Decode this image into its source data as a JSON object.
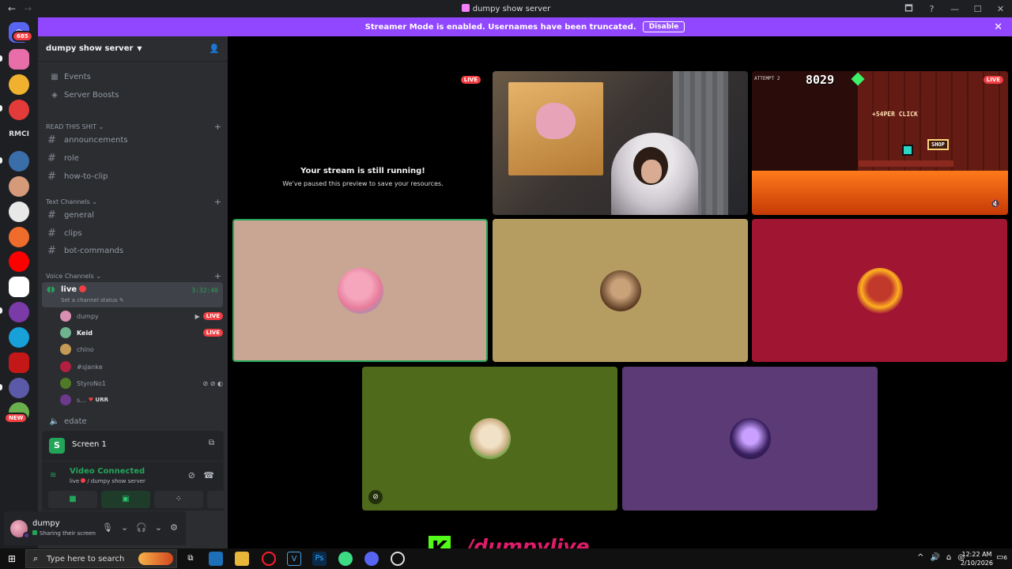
{
  "window": {
    "title": "dumpy show server",
    "back": "←",
    "forward": "→",
    "controls": [
      "🗖",
      "?",
      "—",
      "☐",
      "✕"
    ]
  },
  "banner": {
    "text": "Streamer Mode is enabled. Usernames have been truncated.",
    "button": "Disable",
    "close": "✕"
  },
  "rail": {
    "home_badge": "685",
    "rmci_label": "RMCI",
    "new_badge": "NEW",
    "servers": [
      {
        "color": "#e76ea8"
      },
      {
        "color": "#f0b22e"
      },
      {
        "color": "#e33a3a"
      },
      {
        "color": "#3a6ea8"
      },
      {
        "color": "#d59a7a"
      },
      {
        "color": "#e8e8e8"
      },
      {
        "color": "#f06c2c"
      },
      {
        "color": "#ff0000"
      },
      {
        "color": "#ffffff"
      },
      {
        "color": "#7a3aa8"
      },
      {
        "color": "#18a0d8"
      },
      {
        "color": "#c41818"
      },
      {
        "color": "#5a5aa8"
      },
      {
        "color": "#6ab04c"
      }
    ]
  },
  "sidebar": {
    "server_name": "dumpy show server",
    "top_items": [
      {
        "icon": "▦",
        "label": "Events"
      },
      {
        "icon": "◈",
        "label": "Server Boosts"
      }
    ],
    "categories": {
      "read": "READ THIS SHIT",
      "text": "Text Channels",
      "voice": "Voice Channels"
    },
    "read_channels": [
      "announcements",
      "role",
      "how-to-clip"
    ],
    "text_channels": [
      "general",
      "clips",
      "bot-commands"
    ],
    "voice_live": {
      "name": "live",
      "timer": "3:32:40",
      "status": "Set a channel status"
    },
    "members": [
      {
        "name": "dumpy",
        "color": "#d98fb1",
        "cam": true,
        "live": "LIVE"
      },
      {
        "name": "Keid",
        "color": "#6fb38f",
        "live": "LIVE"
      },
      {
        "name": "chino",
        "color": "#c49a55"
      },
      {
        "name": "#sJankе",
        "color": "#b12040"
      },
      {
        "name": "StyroNo1",
        "color": "#4f7a27",
        "icons": "⊘ ⊘ ◐"
      },
      {
        "name": "s...",
        "color": "#6b3a8a",
        "extra": "URR"
      }
    ],
    "edate": "edate"
  },
  "screen_panel": {
    "label": "Screen 1"
  },
  "voice_panel": {
    "status": "Video Connected",
    "channel": "live",
    "server": "/ dumpy show server"
  },
  "user_panel": {
    "name": "dumpy",
    "status": "Sharing their screen"
  },
  "stage": {
    "paused_title": "Your stream is still running!",
    "paused_sub": "We've paused this preview to save your resources.",
    "live_tag": "LIVE",
    "game": {
      "score": "8029",
      "attempt": "ATTEMPT 2",
      "per_click": "+54PER CLICK",
      "shop": "SHOP"
    },
    "tiles": [
      {
        "bg": "#c9a593"
      },
      {
        "bg": "#b59d62"
      },
      {
        "bg": "#a01532"
      },
      {
        "bg": "#4f6a1b"
      },
      {
        "bg": "#5c3a75"
      }
    ]
  },
  "overlay": {
    "k": "K",
    "handle": "/dumpylive"
  },
  "taskbar": {
    "search_placeholder": "Type here to search",
    "time": "12:22 AM",
    "date": "2/10/2026",
    "notifications": "6"
  }
}
